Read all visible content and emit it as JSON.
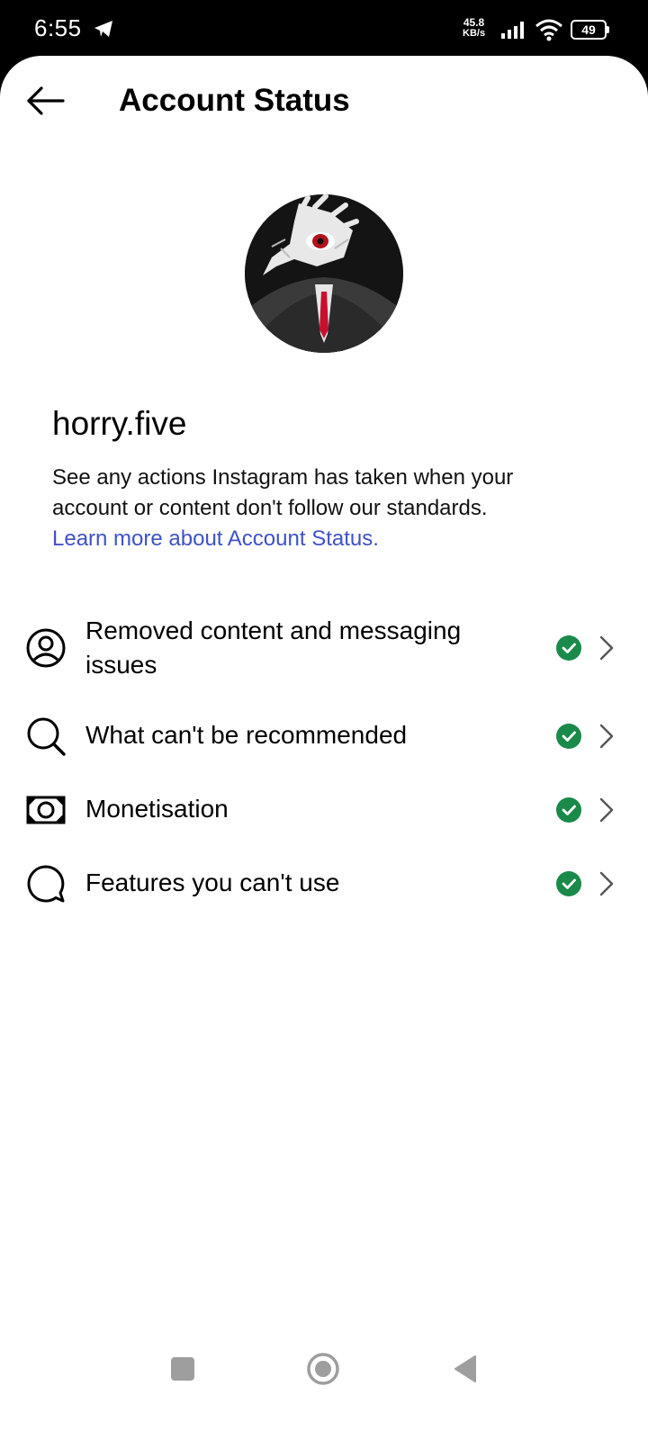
{
  "status_bar": {
    "time": "6:55",
    "speed_value": "45.8",
    "speed_unit": "KB/s",
    "battery": "49"
  },
  "header": {
    "title": "Account Status"
  },
  "profile": {
    "username": "horry.five",
    "description": "See any actions Instagram has taken when your account or content don't follow our standards.",
    "learn_more": "Learn more about Account Status."
  },
  "rows": [
    {
      "label": "Removed content and messaging issues",
      "icon": "profile-circle-icon",
      "status": "ok"
    },
    {
      "label": "What can't be recommended",
      "icon": "search-icon",
      "status": "ok"
    },
    {
      "label": "Monetisation",
      "icon": "money-icon",
      "status": "ok"
    },
    {
      "label": "Features you can't use",
      "icon": "chat-bubble-icon",
      "status": "ok"
    }
  ],
  "colors": {
    "link": "#3f51c9",
    "status_ok": "#1a8a4a"
  }
}
